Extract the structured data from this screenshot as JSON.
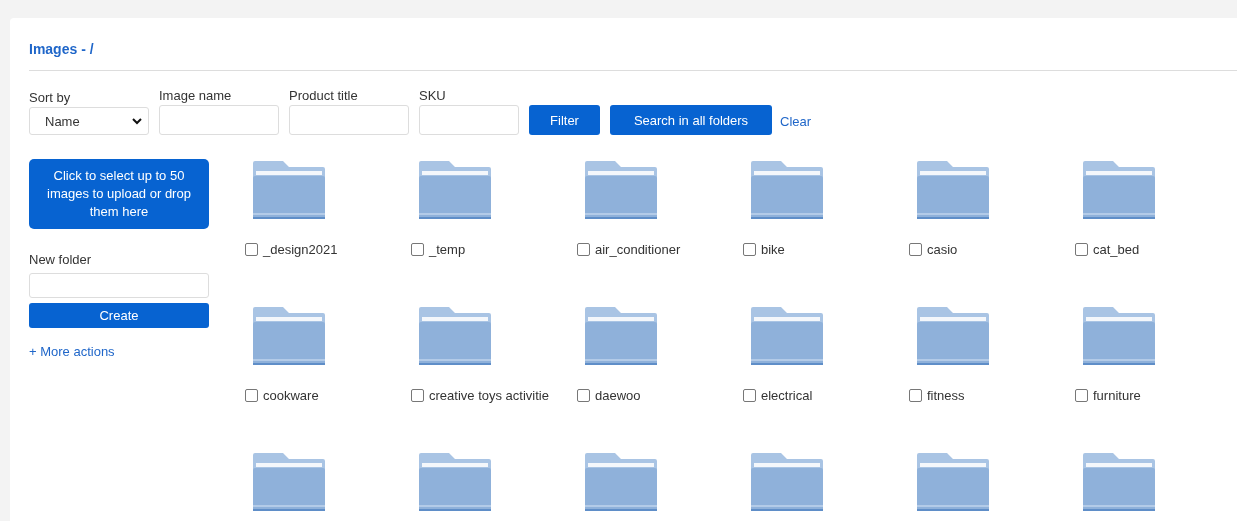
{
  "title": "Images - /",
  "filters": {
    "sort_by": {
      "label": "Sort by",
      "value": "Name"
    },
    "image_name": {
      "label": "Image name"
    },
    "product_title": {
      "label": "Product title"
    },
    "sku": {
      "label": "SKU"
    }
  },
  "buttons": {
    "filter": "Filter",
    "search_all": "Search in all folders",
    "clear": "Clear"
  },
  "sidebar": {
    "upload": "Click to select up to 50 images to upload or drop them here",
    "new_folder_label": "New folder",
    "create": "Create",
    "more_actions": "+ More actions"
  },
  "folders": [
    {
      "kind": "named",
      "name": "_design2021",
      "checked": false
    },
    {
      "kind": "named",
      "name": "_temp",
      "checked": false
    },
    {
      "kind": "named",
      "name": "air_conditioner",
      "checked": false
    },
    {
      "kind": "named",
      "name": "bike",
      "checked": false
    },
    {
      "kind": "named",
      "name": "casio",
      "checked": false
    },
    {
      "kind": "named",
      "name": "cat_bed",
      "checked": false
    },
    {
      "kind": "named",
      "name": "cookware",
      "checked": false
    },
    {
      "kind": "named",
      "name": "creative toys activitie",
      "checked": false
    },
    {
      "kind": "named",
      "name": "daewoo",
      "checked": false
    },
    {
      "kind": "named",
      "name": "electrical",
      "checked": false
    },
    {
      "kind": "named",
      "name": "fitness",
      "checked": false
    },
    {
      "kind": "named",
      "name": "furniture",
      "checked": false
    },
    {
      "kind": "cut_off"
    },
    {
      "kind": "cut_off"
    },
    {
      "kind": "cut_off"
    },
    {
      "kind": "cut_off"
    },
    {
      "kind": "cut_off"
    },
    {
      "kind": "cut_off"
    }
  ]
}
